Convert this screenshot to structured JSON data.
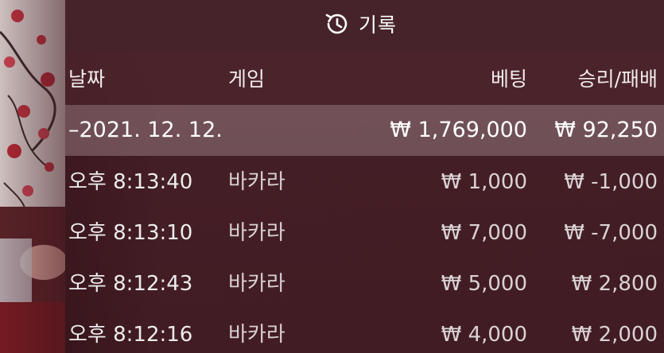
{
  "header": {
    "title": "기록",
    "title_icon": "history-icon"
  },
  "columns": {
    "date": "날짜",
    "game": "게임",
    "bet": "베팅",
    "result": "승리/패배"
  },
  "summary": {
    "date": "–2021. 12. 12.",
    "bet": "₩ 1,769,000",
    "result": "₩ 92,250"
  },
  "rows": [
    {
      "time": "오후 8:13:40",
      "game": "바카라",
      "bet": "₩ 1,000",
      "result": "₩ -1,000"
    },
    {
      "time": "오후 8:13:10",
      "game": "바카라",
      "bet": "₩ 7,000",
      "result": "₩ -7,000"
    },
    {
      "time": "오후 8:12:43",
      "game": "바카라",
      "bet": "₩ 5,000",
      "result": "₩ 2,800"
    },
    {
      "time": "오후 8:12:16",
      "game": "바카라",
      "bet": "₩ 4,000",
      "result": "₩ 2,000"
    }
  ],
  "colors": {
    "panel_bg": "#46242c",
    "summary_bg": "#967a80",
    "text": "#ffffff"
  }
}
